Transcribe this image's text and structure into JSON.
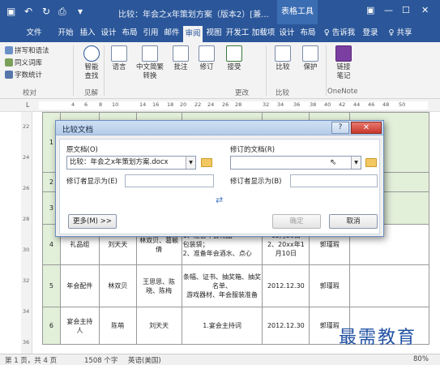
{
  "titlebar": {
    "title": "比较：年会之x年策划方案（版本2）[兼...",
    "context_tab": "表格工具",
    "win_buttons": [
      "▣",
      "—",
      "☐",
      "✕"
    ]
  },
  "tabs": [
    "文件",
    "开始",
    "插入",
    "设计",
    "布局",
    "引用",
    "邮件",
    "审阅",
    "视图",
    "开发工",
    "加载项",
    "设计",
    "布局",
    "♀ 告诉我",
    "登录",
    "♀ 共享"
  ],
  "active_tab": "审阅",
  "ribbon": {
    "proofing": [
      "拼写和语法",
      "同义词库",
      "字数统计"
    ],
    "proofing_group": "校对",
    "smart_lookup": "智能\n查找",
    "insights_group": "见解",
    "language": "语言",
    "chinese_conversion": "中文简繁\n转换",
    "comments": "批注",
    "track": "修订",
    "accept": "接受",
    "changes_group": "更改",
    "compare": "比较",
    "compare_group": "比较",
    "protect": "保护",
    "linked_notes": "链接\n笔记",
    "onenote_group": "OneNote"
  },
  "ruler": {
    "ticks": [
      "4",
      "6",
      "8",
      "10",
      "14",
      "16",
      "18",
      "20",
      "22",
      "24",
      "26",
      "28",
      "32",
      "34",
      "36",
      "38",
      "40",
      "42",
      "44",
      "46",
      "48",
      "50"
    ],
    "v_ticks": [
      "22",
      "24",
      "26",
      "28",
      "30",
      "32",
      "34",
      "36"
    ]
  },
  "table": {
    "rows": [
      [
        "1",
        "",
        "",
        "",
        "",
        "",
        "",
        ""
      ],
      [
        "2",
        "",
        "",
        "",
        "",
        "",
        "",
        ""
      ],
      [
        "3",
        "",
        "",
        "",
        "",
        "",
        "",
        ""
      ],
      [
        "4",
        "礼品组",
        "刘天天",
        "林双贝、葛颖倩",
        "1、准备年会礼品\n包装袋；\n2、准备年会酒水、点心",
        "12月20日\n2、20xx年1\n月10日",
        "郭瑾瑕",
        ""
      ],
      [
        "5",
        "年会配件",
        "林双贝",
        "王思思、陈晓、陈梅",
        "条幅、证书、抽奖箱、抽奖\n名单、\n游戏器材、年会服装准备",
        "2012.12.30",
        "郭瑾瑕",
        ""
      ],
      [
        "6",
        "宴会主持\n人",
        "陈萌",
        "刘天天",
        "1.宴会主持词",
        "2012.12.30",
        "郭瑾瑕",
        ""
      ]
    ]
  },
  "dialog": {
    "title": "比较文档",
    "help": "?",
    "close": "✕",
    "original_label": "原文档(O)",
    "original_value": "比较：年会之x年策划方案.docx",
    "original_reviewer_label": "修订者显示为(E)",
    "revised_label": "修订的文档(R)",
    "revised_reviewer_label": "修订者显示为(B)",
    "swap": "⇄",
    "more_button": "更多(M) >>",
    "ok_button": "确定",
    "cancel_button": "取消"
  },
  "statusbar": {
    "page": "第 1 页，共 4 页",
    "words": "1508 个字",
    "language": "英语(美国)",
    "zoom": "80%"
  },
  "watermark": "最需教育",
  "colors": {
    "accent": "#2b579a",
    "table_header": "#e2efd9"
  }
}
